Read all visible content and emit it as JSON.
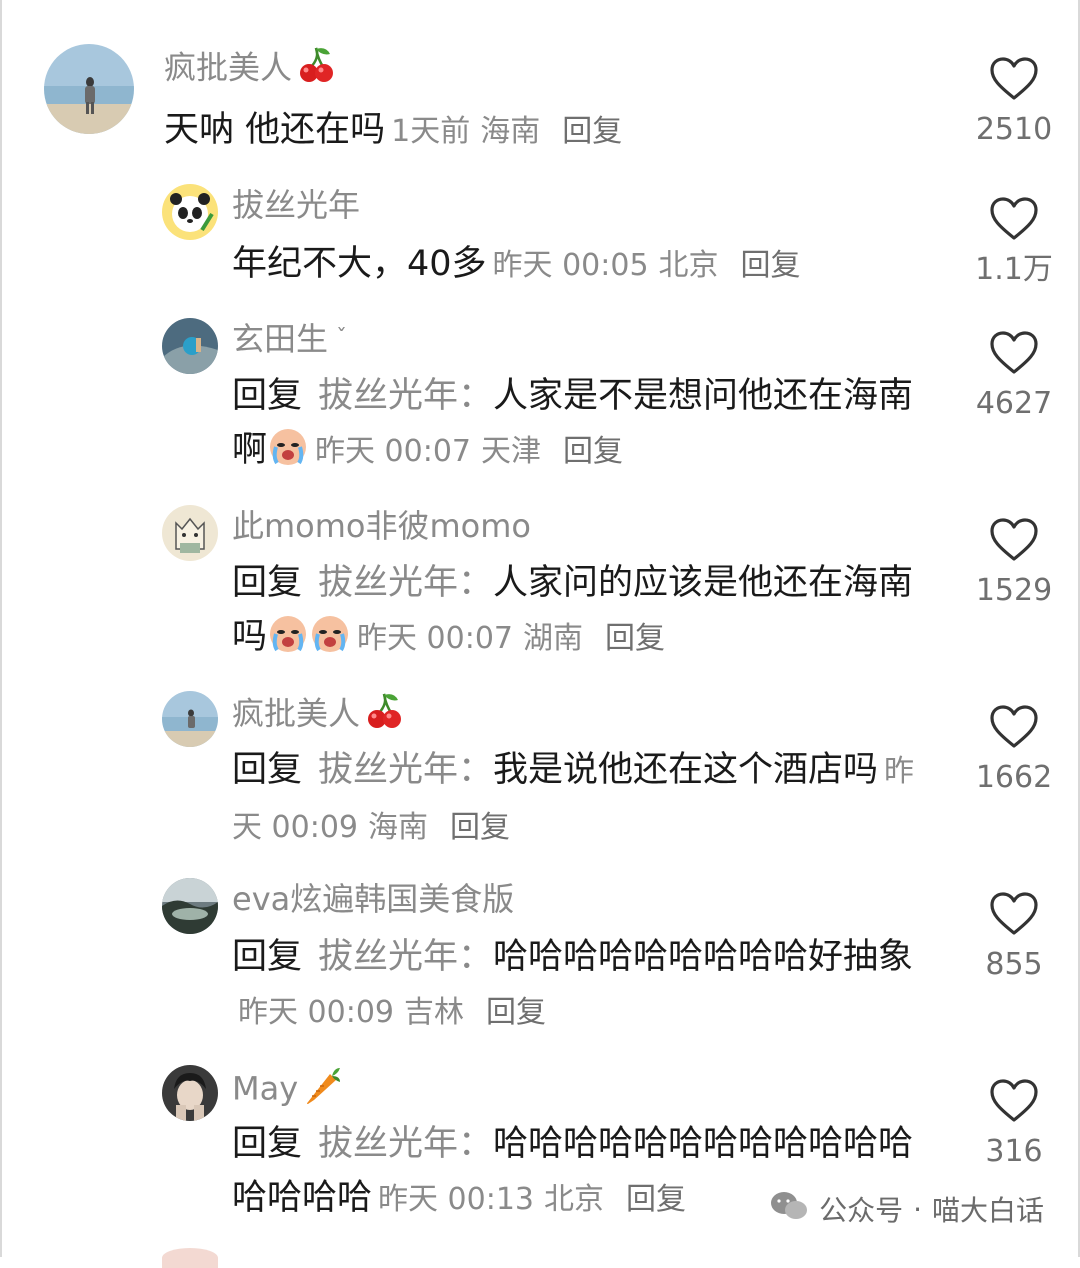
{
  "comments": [
    {
      "username": "疯批美人",
      "badge": "cherry",
      "text": "天呐 他还在吗",
      "time": "1天前",
      "location": "海南",
      "reply_label": "回复",
      "likes": "2510"
    },
    {
      "username": "拔丝光年",
      "badge": "",
      "text": "年纪不大，40多",
      "time": "昨天 00:05",
      "location": "北京",
      "reply_label": "回复",
      "likes": "1.1万"
    },
    {
      "username": "玄田生",
      "badge": "ˇ",
      "reply_prefix": "回复",
      "reply_to": "拔丝光年：",
      "text": "人家是不是想问他还在海南啊",
      "emoji": "crying",
      "time": "昨天 00:07",
      "location": "天津",
      "reply_label": "回复",
      "likes": "4627"
    },
    {
      "username": "此momo非彼momo",
      "badge": "",
      "reply_prefix": "回复",
      "reply_to": "拔丝光年：",
      "text": "人家问的应该是他还在海南吗",
      "emoji": "crying x2",
      "time": "昨天 00:07",
      "location": "湖南",
      "reply_label": "回复",
      "likes": "1529"
    },
    {
      "username": "疯批美人",
      "badge": "cherry",
      "reply_prefix": "回复",
      "reply_to": "拔丝光年：",
      "text": "我是说他还在这个酒店吗",
      "time": "昨天 00:09",
      "location": "海南",
      "reply_label": "回复",
      "likes": "1662"
    },
    {
      "username": "eva炫遍韩国美食版",
      "badge": "",
      "reply_prefix": "回复",
      "reply_to": "拔丝光年：",
      "text": "哈哈哈哈哈哈哈哈哈好抽象",
      "time": "昨天 00:09",
      "location": "吉林",
      "reply_label": "回复",
      "likes": "855"
    },
    {
      "username": "May",
      "badge": "carrot",
      "reply_prefix": "回复",
      "reply_to": "拔丝光年：",
      "text": "哈哈哈哈哈哈哈哈哈哈哈哈哈哈哈哈",
      "time": "昨天 00:13",
      "location": "北京",
      "reply_label": "回复",
      "likes": "316"
    }
  ],
  "watermark": {
    "source": "公众号",
    "separator": "·",
    "account": "喵大白话"
  },
  "icons": {
    "like": "heart-outline-icon",
    "cherry": "cherry-icon",
    "carrot": "carrot-icon",
    "crying": "crying-face-icon",
    "wechat": "wechat-icon"
  },
  "colors": {
    "username": "#8a8a8a",
    "body_text": "#1a1a1a",
    "meta": "#8a8a8a",
    "heart_stroke": "#333333"
  }
}
